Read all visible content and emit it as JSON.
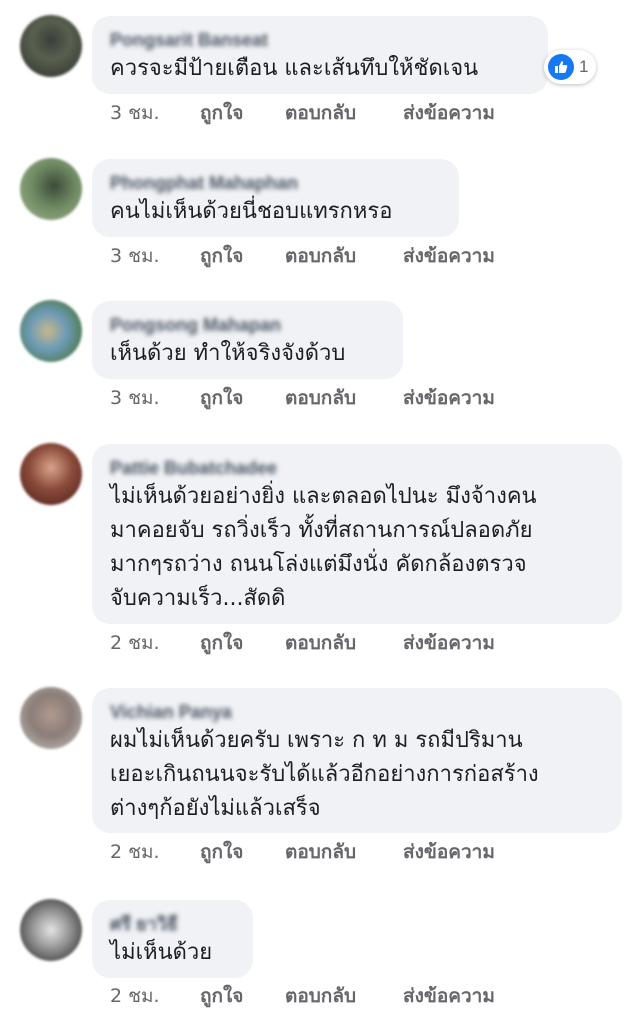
{
  "comments": [
    {
      "author": "Pongsarit Banseat",
      "text": "ควรจะมีป้ายเตือน และเส้นทึบให้ชัดเจน",
      "time": "3 ชม.",
      "reactions": "1"
    },
    {
      "author": "Phongphat Mahaphan",
      "text": "คนไม่เห็นด้วยนี่ชอบแทรกหรอ",
      "time": "3 ชม."
    },
    {
      "author": "Pongsong Mahapan",
      "text": "เห็นด้วย ทำให้จริงจังด้วบ",
      "time": "3 ชม."
    },
    {
      "author": "Pattie Bubatchadee",
      "text": "ไม่เห็นด้วยอย่างยิ่ง และตลอดไปนะ มึงจ้างคน\nมาคอยจับ รถวิ่งเร็ว ทั้งที่สถานการณ์ปลอดภัย\nมากๆรถว่าง ถนนโล่งแต่มึงนั่ง คัดกล้องตรวจ\nจับความเร็ว...สัดดิ",
      "time": "2 ชม."
    },
    {
      "author": "Vichian Panya",
      "text": "ผมไม่เห็นด้วยครับ เพราะ ก ท ม รถมีปริมาน\nเยอะเกินถนนจะรับได้แล้วอีกอย่างการก่อสร้าง\nต่างๆก้อยังไม่แล้วเสร็จ",
      "time": "2 ชม."
    },
    {
      "author": "ศรี ยาวิธี",
      "text": "ไม่เห็นด้วย",
      "time": "2 ชม."
    }
  ],
  "actions": {
    "like": "ถูกใจ",
    "reply": "ตอบกลับ",
    "message": "ส่งข้อความ"
  },
  "colors": {
    "bubble": "#f0f2f5",
    "meta": "#65676b",
    "like_blue": "#1877f2"
  },
  "icons": {
    "reaction": "thumbs-up-icon"
  }
}
